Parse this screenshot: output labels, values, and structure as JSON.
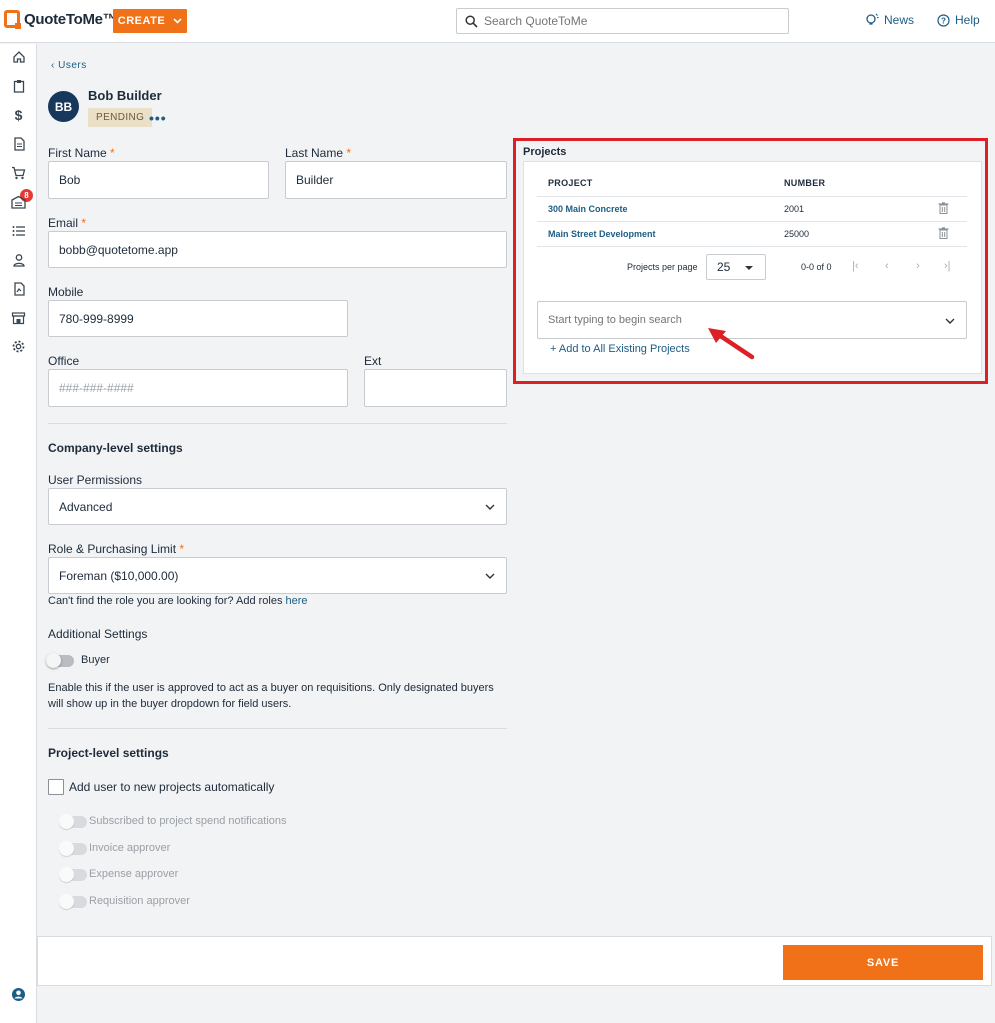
{
  "app": {
    "name": "QuoteToMe™",
    "brand_color": "#f07118",
    "link_color": "#1c5d85",
    "highlight_color": "#dd1f26"
  },
  "header": {
    "create_label": "CREATE",
    "search_placeholder": "Search QuoteToMe",
    "news_label": "News",
    "help_label": "Help"
  },
  "sidebar": {
    "icons": [
      "home-icon",
      "clipboard-icon",
      "dollar-icon",
      "document-icon",
      "cart-icon",
      "warehouse-icon",
      "list-icon",
      "person-icon",
      "report-icon",
      "store-icon",
      "gear-icon"
    ],
    "badge_count": "8",
    "account_icon": "account-circle-icon"
  },
  "breadcrumb": {
    "back_label": "Users"
  },
  "user": {
    "initials": "BB",
    "name": "Bob Builder",
    "status": "PENDING",
    "more_label": "•••"
  },
  "form": {
    "first_name_label": "First Name",
    "first_name_value": "Bob",
    "last_name_label": "Last Name",
    "last_name_value": "Builder",
    "email_label": "Email",
    "email_value": "bobb@quotetome.app",
    "mobile_label": "Mobile",
    "mobile_value": "780-999-8999",
    "office_label": "Office",
    "office_placeholder": "###-###-####",
    "ext_label": "Ext",
    "required_mark": "*"
  },
  "company_settings": {
    "title": "Company-level settings",
    "permissions_label": "User Permissions",
    "permissions_value": "Advanced",
    "role_label": "Role & Purchasing Limit",
    "role_value": "Foreman ($10,000.00)",
    "role_help": "Can't find the role you are looking for? Add roles",
    "role_help_link": "here",
    "additional_title": "Additional Settings",
    "buyer_label": "Buyer",
    "buyer_on": false,
    "buyer_help": "Enable this if the user is approved to act as a buyer on requisitions. Only designated buyers will show up in the buyer dropdown for field users."
  },
  "project_settings": {
    "title": "Project-level settings",
    "auto_add_label": "Add user to new projects automatically",
    "auto_add_checked": false,
    "toggles": [
      "Subscribed to project spend notifications",
      "Invoice approver",
      "Expense approver",
      "Requisition approver"
    ]
  },
  "projects": {
    "title": "Projects",
    "columns": [
      "PROJECT",
      "NUMBER"
    ],
    "rows": [
      {
        "name": "300 Main Concrete",
        "number": "2001"
      },
      {
        "name": "Main Street Development",
        "number": "25000"
      }
    ],
    "per_page_label": "Projects per page",
    "per_page_value": "25",
    "range_text": "0-0 of 0",
    "search_placeholder": "Start typing to begin search",
    "add_all_label": "Add to All Existing Projects"
  },
  "footer": {
    "save_label": "SAVE"
  }
}
